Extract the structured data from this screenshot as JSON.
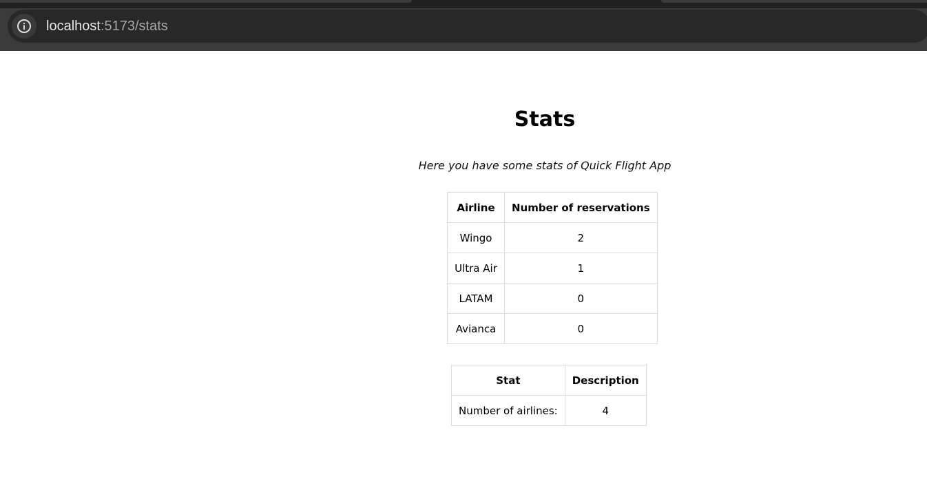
{
  "browser": {
    "url_host": "localhost",
    "url_path": ":5173/stats",
    "info_icon": "info-icon"
  },
  "page": {
    "title": "Stats",
    "subtitle": "Here you have some stats of Quick Flight App"
  },
  "airlines_table": {
    "headers": [
      "Airline",
      "Number of reservations"
    ],
    "rows": [
      [
        "Wingo",
        "2"
      ],
      [
        "Ultra Air",
        "1"
      ],
      [
        "LATAM",
        "0"
      ],
      [
        "Avianca",
        "0"
      ]
    ]
  },
  "stats_table": {
    "headers": [
      "Stat",
      "Description"
    ],
    "rows": [
      [
        "Number of airlines:",
        "4"
      ]
    ]
  }
}
